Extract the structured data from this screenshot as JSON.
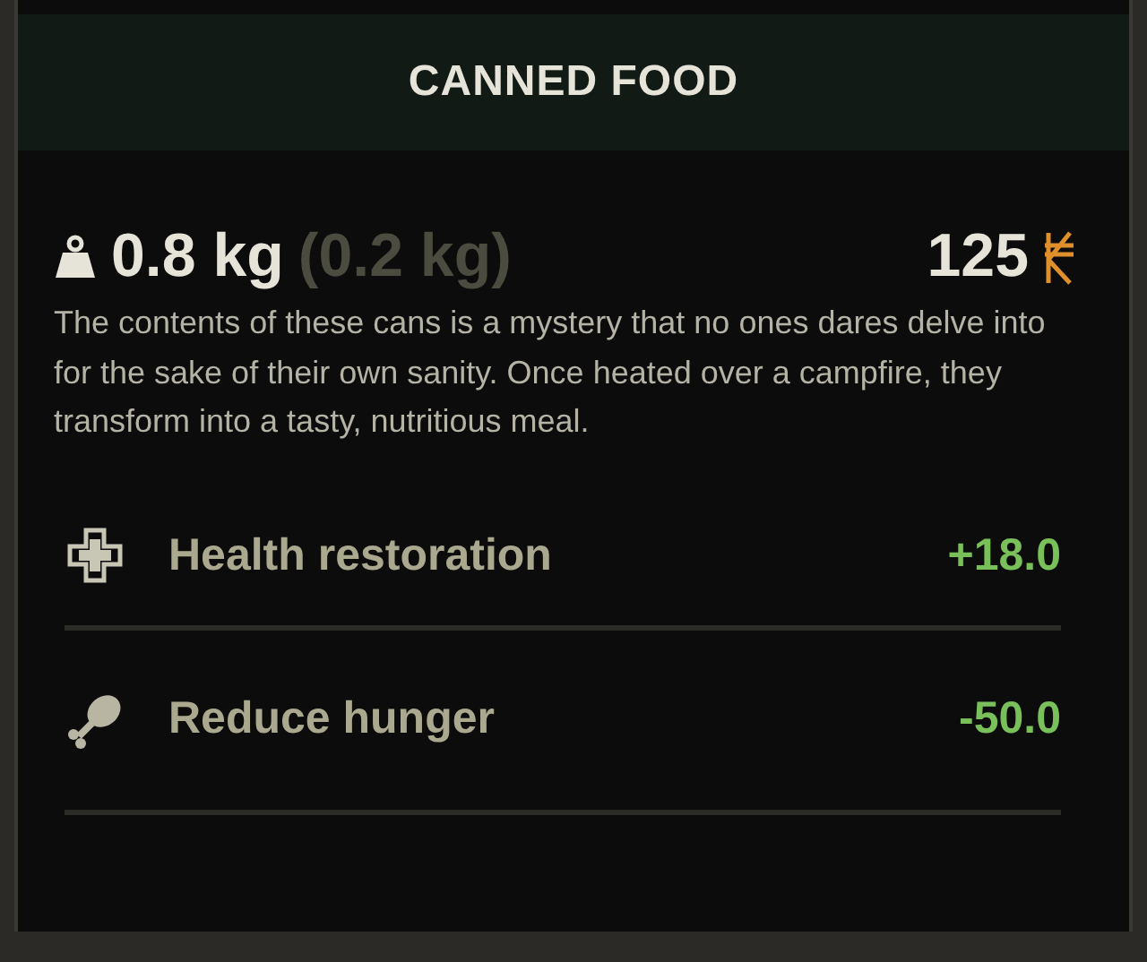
{
  "title": "CANNED FOOD",
  "weight": "0.8 kg",
  "unit_weight": "(0.2 kg)",
  "price": "125",
  "description": "The contents of these cans is a mystery that no ones dares delve into for the sake of their own sanity. Once heated over a campfire, they transform into a tasty, nutritious meal.",
  "stats": [
    {
      "kind": "health",
      "label": "Health restoration",
      "value": "+18.0"
    },
    {
      "kind": "hunger",
      "label": "Reduce hunger",
      "value": "-50.0"
    }
  ]
}
